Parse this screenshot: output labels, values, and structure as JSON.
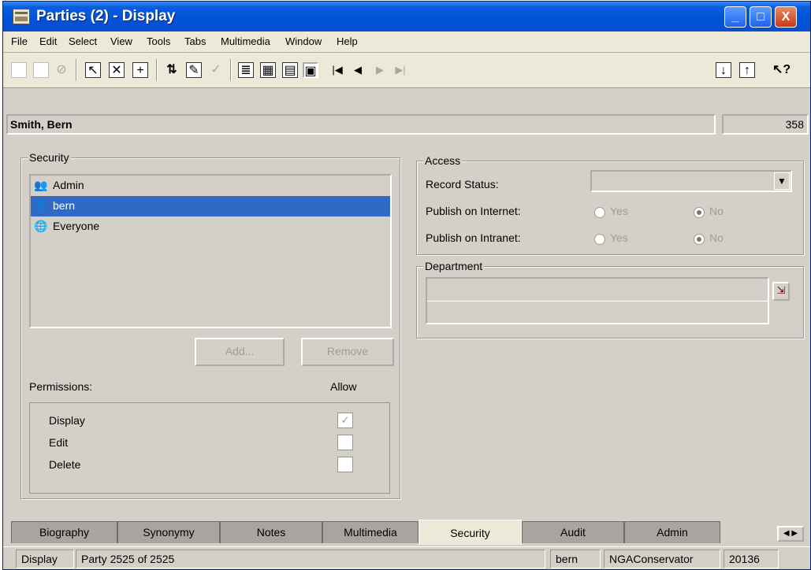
{
  "window": {
    "title": "Parties (2) - Display",
    "controls": [
      "_",
      "□",
      "X"
    ]
  },
  "menu": [
    "File",
    "Edit",
    "Select",
    "View",
    "Tools",
    "Tabs",
    "Multimedia",
    "Window",
    "Help"
  ],
  "record": {
    "name": "Smith, Bern",
    "id": "358"
  },
  "security": {
    "label": "Security",
    "items": [
      {
        "label": "Admin",
        "icon": "admin-group-icon"
      },
      {
        "label": "bern",
        "icon": "user-icon"
      },
      {
        "label": "Everyone",
        "icon": "globe-icon"
      }
    ],
    "add_label": "Add...",
    "remove_label": "Remove"
  },
  "permissions": {
    "label": "Permissions:",
    "allow_label": "Allow",
    "items": [
      {
        "label": "Display",
        "checked": true
      },
      {
        "label": "Edit",
        "checked": false
      },
      {
        "label": "Delete",
        "checked": false
      }
    ]
  },
  "access": {
    "label": "Access",
    "record_status_label": "Record Status:",
    "record_status_value": "",
    "internet_label": "Publish on Internet:",
    "intranet_label": "Publish on Intranet:",
    "yes": "Yes",
    "no": "No",
    "internet_value": "No",
    "intranet_value": "No"
  },
  "department": {
    "label": "Department",
    "value": ""
  },
  "tabs": [
    "Biography",
    "Synonymy",
    "Notes",
    "Multimedia",
    "Security",
    "Audit",
    "Admin"
  ],
  "active_tab": "Security",
  "status": {
    "mode": "Display",
    "position": "Party 2525 of 2525",
    "user": "bern",
    "role": "NGAConservator",
    "number": "20136"
  }
}
